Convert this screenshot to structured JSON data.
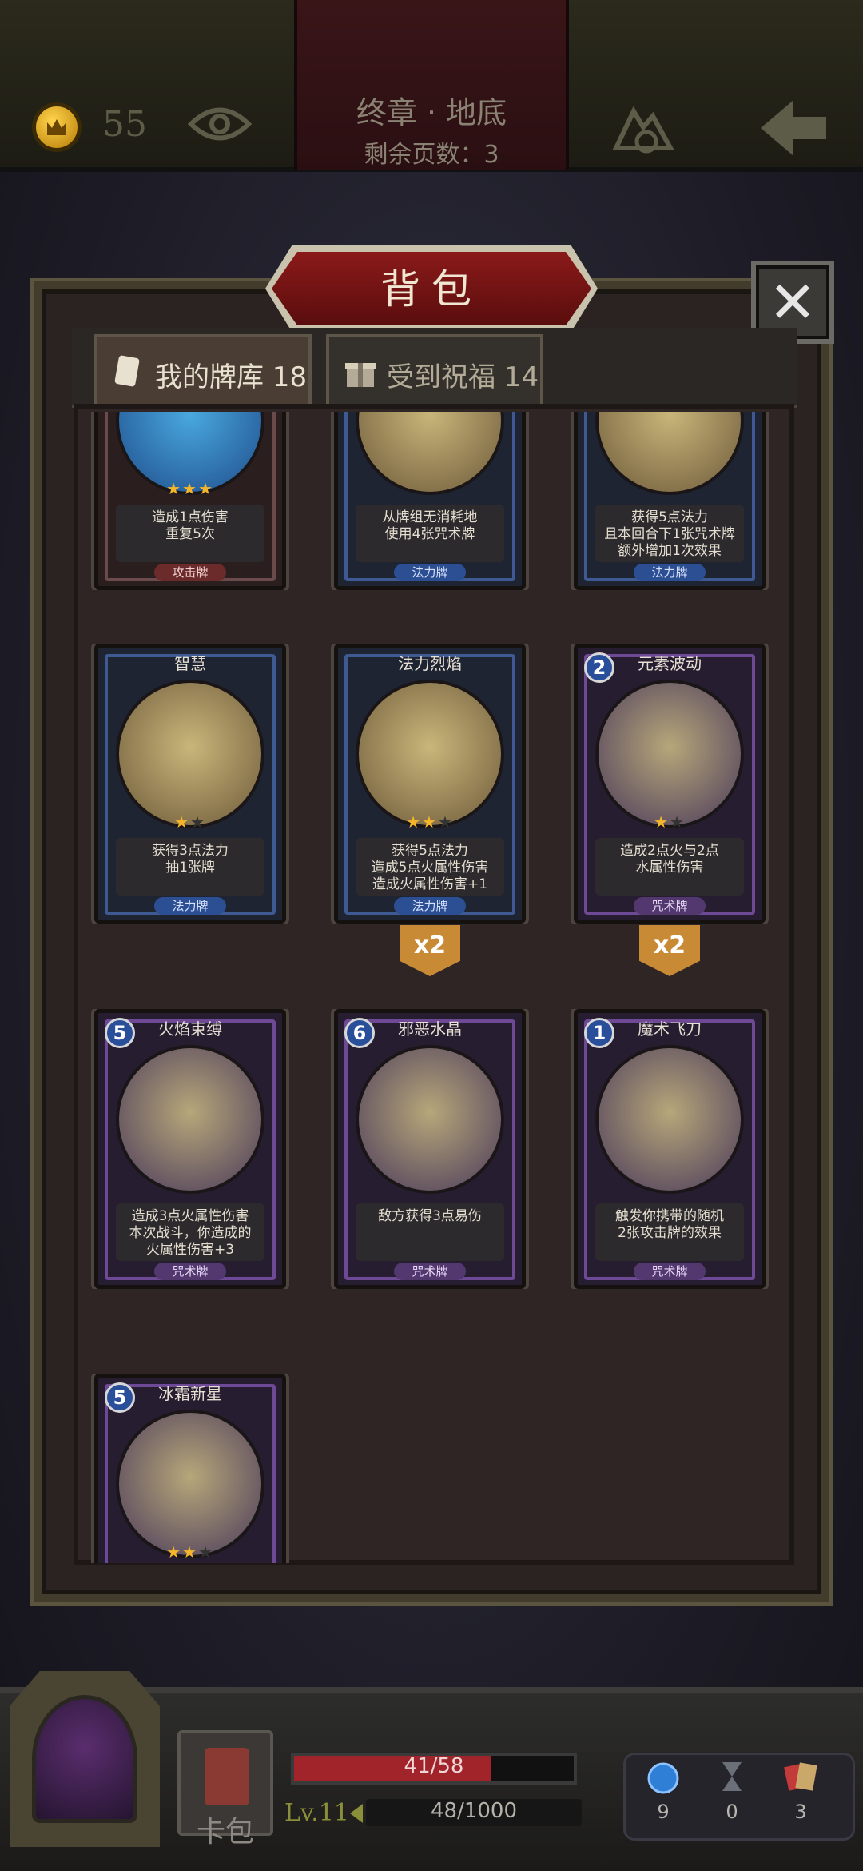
{
  "top_bar": {
    "gold": "55",
    "chapter_title": "终章 · 地底",
    "pages_remaining": "剩余页数：3"
  },
  "backpack": {
    "title": "背包",
    "tabs": [
      {
        "label": "我的牌库 18",
        "active": true
      },
      {
        "label": "受到祝福 14",
        "active": false
      }
    ]
  },
  "cards": [
    {
      "name": "",
      "cost": "",
      "type": "攻击牌",
      "stars": 3,
      "desc": "造成1点伤害\n重复5次",
      "kind": "attack"
    },
    {
      "name": "",
      "cost": "",
      "type": "法力牌",
      "stars": 0,
      "desc": "从牌组无消耗地\n使用4张咒术牌",
      "kind": "mana"
    },
    {
      "name": "",
      "cost": "",
      "type": "法力牌",
      "stars": 0,
      "desc": "获得5点法力\n且本回合下1张咒术牌\n额外增加1次效果",
      "kind": "mana"
    },
    {
      "name": "智慧",
      "cost": "",
      "type": "法力牌",
      "stars": 1,
      "desc": "获得3点法力\n抽1张牌",
      "kind": "mana"
    },
    {
      "name": "法力烈焰",
      "cost": "",
      "type": "法力牌",
      "stars": 2,
      "desc": "获得5点法力\n造成5点火属性伤害\n造成火属性伤害+1",
      "kind": "mana",
      "multiplier": "x2"
    },
    {
      "name": "元素波动",
      "cost": "2",
      "type": "咒术牌",
      "stars": 1,
      "desc": "造成2点火与2点\n水属性伤害",
      "kind": "spell",
      "multiplier": "x2"
    },
    {
      "name": "火焰束缚",
      "cost": "5",
      "type": "咒术牌",
      "stars": 0,
      "desc": "造成3点火属性伤害\n本次战斗，你造成的\n火属性伤害+3",
      "kind": "spell"
    },
    {
      "name": "邪恶水晶",
      "cost": "6",
      "type": "咒术牌",
      "stars": 0,
      "desc": "敌方获得3点易伤",
      "kind": "spell"
    },
    {
      "name": "魔术飞刀",
      "cost": "1",
      "type": "咒术牌",
      "stars": 0,
      "desc": "触发你携带的随机\n2张攻击牌的效果",
      "kind": "spell"
    },
    {
      "name": "冰霜新星",
      "cost": "5",
      "type": "",
      "stars": 2,
      "desc": "",
      "kind": "spell"
    }
  ],
  "bottom_bar": {
    "hp": "41/58",
    "hp_fraction": 0.707,
    "level": "Lv.11",
    "xp": "48/1000",
    "book_label": "卡包",
    "resources": [
      {
        "icon": "potion-orb-icon",
        "value": "9"
      },
      {
        "icon": "hourglass-icon",
        "value": "0"
      },
      {
        "icon": "cards-icon",
        "value": "3"
      }
    ]
  },
  "colors": {
    "mana_card": "#3f5a92",
    "spell_card": "#6e4a96",
    "attack_card": "#6a4a4a",
    "hp_bar": "#a0242a",
    "star": "#f5b62b"
  }
}
